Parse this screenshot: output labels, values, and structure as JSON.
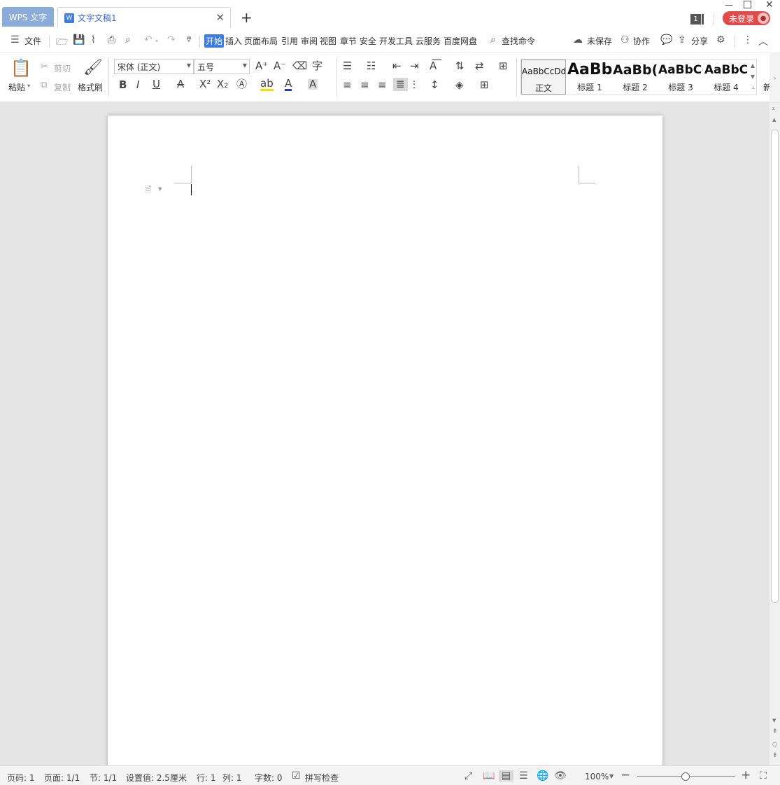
{
  "titlebar": {
    "app_tab": "WPS 文字",
    "doc_tab": "文字文稿1",
    "doc_icon": "W",
    "window_count": "1",
    "login": "未登录"
  },
  "menu": {
    "file": "文件",
    "tabs": [
      "开始",
      "插入",
      "页面布局",
      "引用",
      "审阅",
      "视图",
      "章节",
      "安全",
      "开发工具",
      "云服务",
      "百度网盘"
    ],
    "active_tab": "开始",
    "search": "查找命令",
    "unsaved": "未保存",
    "collab": "协作",
    "share": "分享"
  },
  "ribbon": {
    "paste": "粘贴",
    "cut": "剪切",
    "copy": "复制",
    "format_painter": "格式刷",
    "font_name": "宋体 (正文)",
    "font_size": "五号",
    "styles": [
      {
        "sample": "AaBbCcDd",
        "name": "正文"
      },
      {
        "sample": "AaBb",
        "name": "标题 1"
      },
      {
        "sample": "AaBb(",
        "name": "标题 2"
      },
      {
        "sample": "AaBbC(",
        "name": "标题 3"
      },
      {
        "sample": "AaBbC",
        "name": "标题 4"
      }
    ],
    "new_style_partial": "新"
  },
  "status": {
    "page_no": "页码: 1",
    "pages": "页面: 1/1",
    "section": "节: 1/1",
    "setting": "设置值: 2.5厘米",
    "row": "行: 1",
    "col": "列: 1",
    "word_count": "字数: 0",
    "spell_check": "拼写检查",
    "zoom": "100%"
  },
  "colors": {
    "accent": "#3b7be3",
    "login": "#e24a4a",
    "app_tab": "#8bacd9"
  }
}
